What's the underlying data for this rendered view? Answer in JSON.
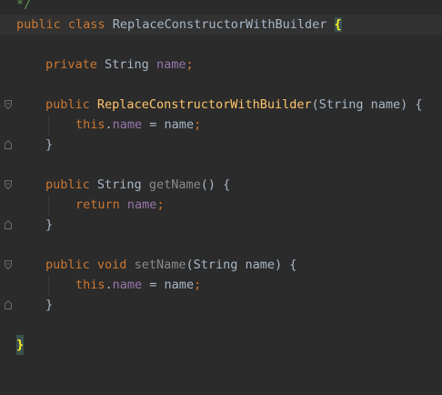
{
  "comment_end": "*/",
  "class_decl": {
    "kw_public": "public",
    "kw_class": "class",
    "name": "ReplaceConstructorWithBuilder",
    "brace": "{"
  },
  "field_decl": {
    "kw_private": "private",
    "type": "String",
    "field": "name",
    "semi": ";"
  },
  "ctor": {
    "kw_public": "public",
    "name": "ReplaceConstructorWithBuilder",
    "params": "(String name) {",
    "this_kw": "this",
    "dot": ".",
    "field": "name",
    "assign": " = name",
    "semi": ";",
    "close": "}"
  },
  "getter": {
    "kw_public": "public",
    "type": "String",
    "name": "getName",
    "sig": "() {",
    "kw_return": "return",
    "field": "name",
    "semi": ";",
    "close": "}"
  },
  "setter": {
    "kw_public": "public",
    "kw_void": "void",
    "name": "setName",
    "params": "(String name) {",
    "this_kw": "this",
    "dot": ".",
    "field": "name",
    "assign": " = name",
    "semi": ";",
    "close": "}"
  },
  "class_close": "}",
  "colors": {
    "background": "#2b2b2b",
    "keyword": "#cc7832",
    "field": "#9876aa",
    "method_decl": "#ffc66d",
    "text": "#a9b7c6",
    "comment": "#629755",
    "brace_match": "#ffef28"
  }
}
